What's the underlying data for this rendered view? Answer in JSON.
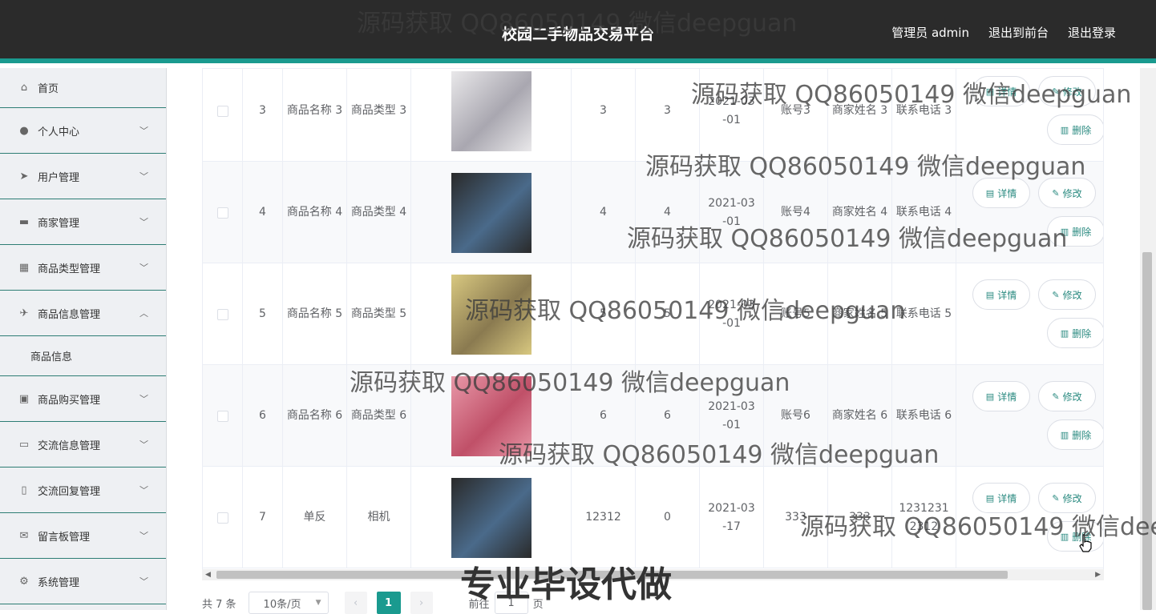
{
  "app": {
    "title": "校园二手物品交易平台",
    "nav": {
      "user": "管理员 admin",
      "front": "退出到前台",
      "logout": "退出登录"
    }
  },
  "sidebar": {
    "items": [
      {
        "label": "首页",
        "icon": "home-icon"
      },
      {
        "label": "个人中心",
        "icon": "user-icon"
      },
      {
        "label": "用户管理",
        "icon": "send-icon"
      },
      {
        "label": "商家管理",
        "icon": "briefcase-icon"
      },
      {
        "label": "商品类型管理",
        "icon": "grid-icon"
      },
      {
        "label": "商品信息管理",
        "icon": "plane-icon"
      },
      {
        "label": "商品购买管理",
        "icon": "clipboard-icon"
      },
      {
        "label": "交流信息管理",
        "icon": "monitor-icon"
      },
      {
        "label": "交流回复管理",
        "icon": "phone-icon"
      },
      {
        "label": "留言板管理",
        "icon": "mail-icon"
      },
      {
        "label": "系统管理",
        "icon": "settings-icon"
      }
    ],
    "submenu": "商品信息"
  },
  "table": {
    "rows": [
      {
        "idx": "3",
        "name": "商品名称 3",
        "type": "商品类型 3",
        "a": "3",
        "b": "3",
        "date": "2021-03 -01",
        "acct": "账号3",
        "merchant": "商家姓名 3",
        "phone": "联系电话 3"
      },
      {
        "idx": "4",
        "name": "商品名称 4",
        "type": "商品类型 4",
        "a": "4",
        "b": "4",
        "date": "2021-03 -01",
        "acct": "账号4",
        "merchant": "商家姓名 4",
        "phone": "联系电话 4"
      },
      {
        "idx": "5",
        "name": "商品名称 5",
        "type": "商品类型 5",
        "a": "5",
        "b": "5",
        "date": "2021-03 -01",
        "acct": "账号5",
        "merchant": "商家姓名 5",
        "phone": "联系电话 5"
      },
      {
        "idx": "6",
        "name": "商品名称 6",
        "type": "商品类型 6",
        "a": "6",
        "b": "6",
        "date": "2021-03 -01",
        "acct": "账号6",
        "merchant": "商家姓名 6",
        "phone": "联系电话 6"
      },
      {
        "idx": "7",
        "name": "单反",
        "type": "相机",
        "a": "12312",
        "b": "0",
        "date": "2021-03 -17",
        "acct": "333",
        "merchant": "333",
        "phone": "1231231 2312"
      }
    ],
    "actions": {
      "detail": "详情",
      "edit": "修改",
      "delete": "删除"
    }
  },
  "pager": {
    "total": "共 7 条",
    "pagesize": "10条/页",
    "current": "1",
    "goto": "前往",
    "goto_value": "1",
    "page_unit": "页"
  },
  "watermark": {
    "text": "源码获取 QQ86050149 微信deepguan",
    "big": "专业毕设代做"
  },
  "colors": {
    "accent": "#1a9a8f",
    "topbar": "#2b2b2b"
  }
}
